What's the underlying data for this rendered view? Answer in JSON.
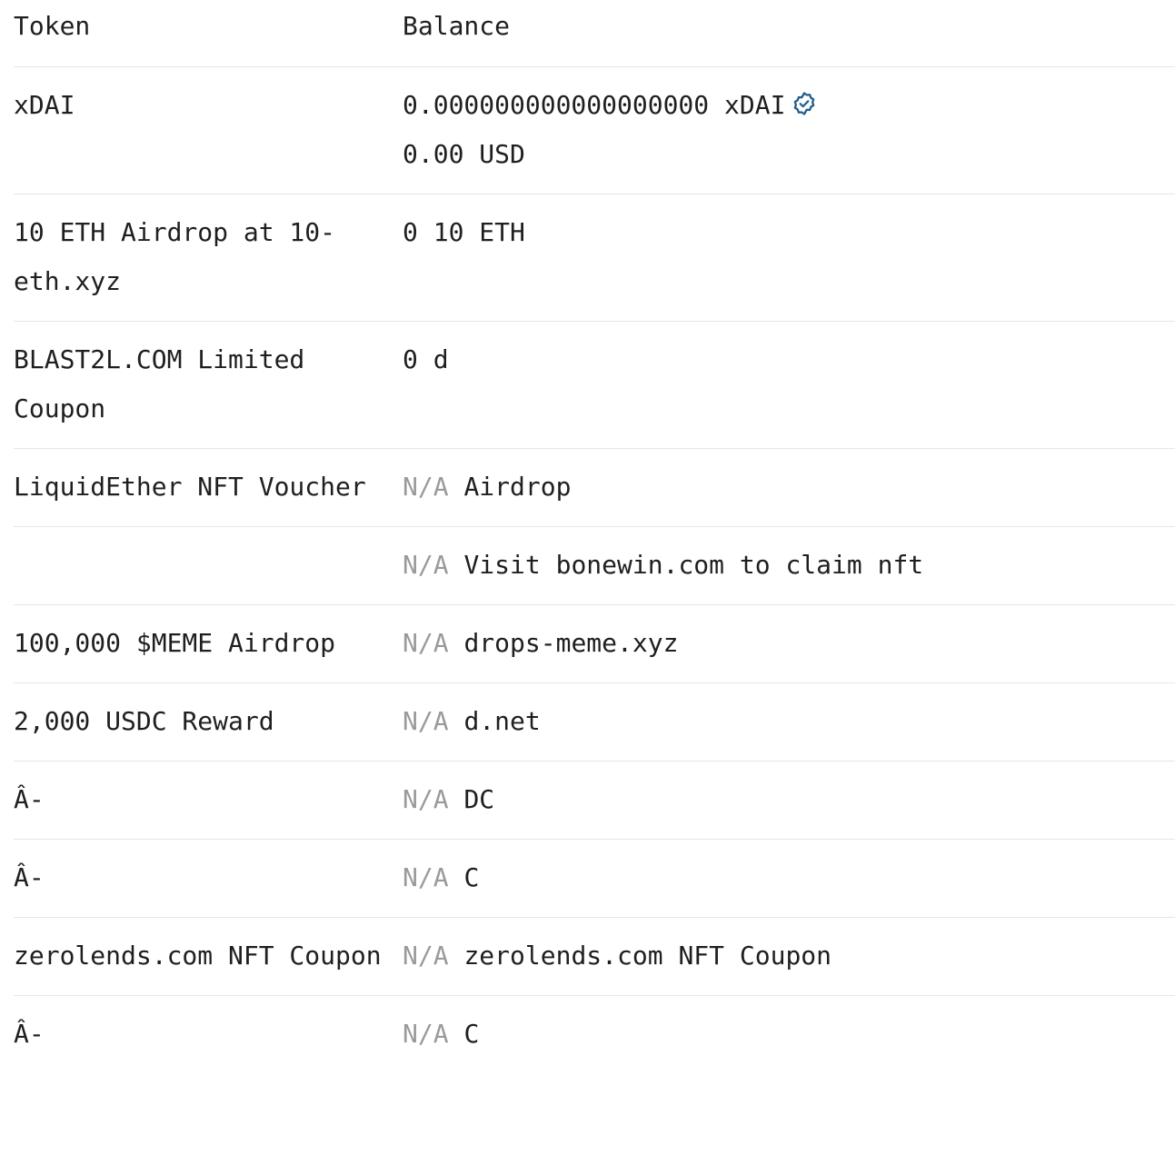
{
  "header": {
    "token_label": "Token",
    "balance_label": "Balance"
  },
  "verified_color": "#1f5d8c",
  "rows": [
    {
      "token": "xDAI",
      "balance_amount": "0.000000000000000000 xDAI",
      "balance_usd": "0.00 USD",
      "verified_icon": "verified-badge-icon"
    },
    {
      "token": "10 ETH Airdrop at 10-eth.xyz",
      "balance_amount": "0 10 ETH"
    },
    {
      "token": "BLAST2L.COM Limited Coupon",
      "balance_amount": "0 d"
    },
    {
      "token": "LiquidEther NFT Voucher",
      "na": "N/A",
      "balance_amount": "Airdrop"
    },
    {
      "token": "",
      "na": "N/A",
      "balance_amount": "Visit bonewin.com to claim nft"
    },
    {
      "token": "100,000 $MEME Airdrop",
      "na": "N/A",
      "balance_amount": "drops-meme.xyz"
    },
    {
      "token": "2,000 USDC Reward",
      "na": "N/A",
      "balance_amount": "d.net"
    },
    {
      "token": "Â-",
      "na": "N/A",
      "balance_amount": "DC"
    },
    {
      "token": "Â-",
      "na": "N/A",
      "balance_amount": "C"
    },
    {
      "token": "zerolends.com NFT Coupon",
      "na": "N/A",
      "balance_amount": "zerolends.com NFT Coupon"
    },
    {
      "token": "Â-",
      "na": "N/A",
      "balance_amount": "C"
    }
  ]
}
